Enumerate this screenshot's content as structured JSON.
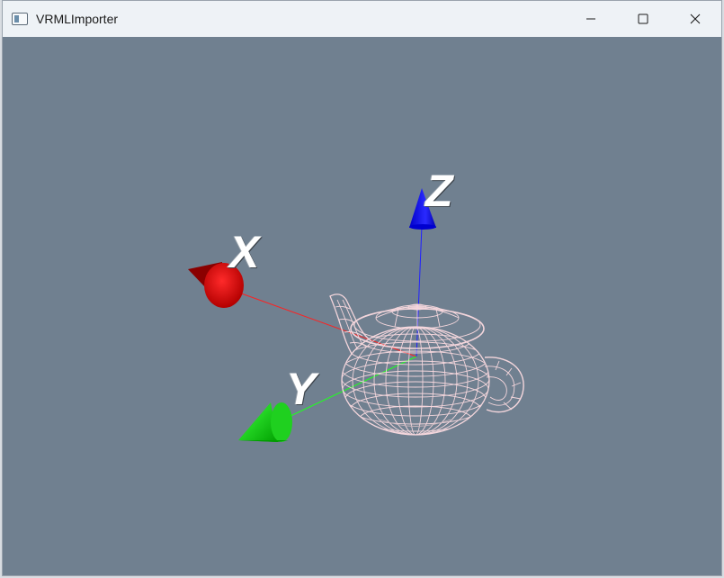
{
  "window": {
    "title": "VRMLImporter",
    "icons": {
      "app": "application-window-icon",
      "minimize": "minimize-icon",
      "maximize": "maximize-icon",
      "close": "close-icon"
    }
  },
  "viewport": {
    "background_color": "#708090",
    "axes": {
      "x": {
        "label": "X",
        "color": "#e00000"
      },
      "y": {
        "label": "Y",
        "color": "#00cc00"
      },
      "z": {
        "label": "Z",
        "color": "#0000ee"
      }
    },
    "model": {
      "name": "teapot",
      "render_style": "wireframe",
      "color": "#f4d6dc"
    }
  }
}
